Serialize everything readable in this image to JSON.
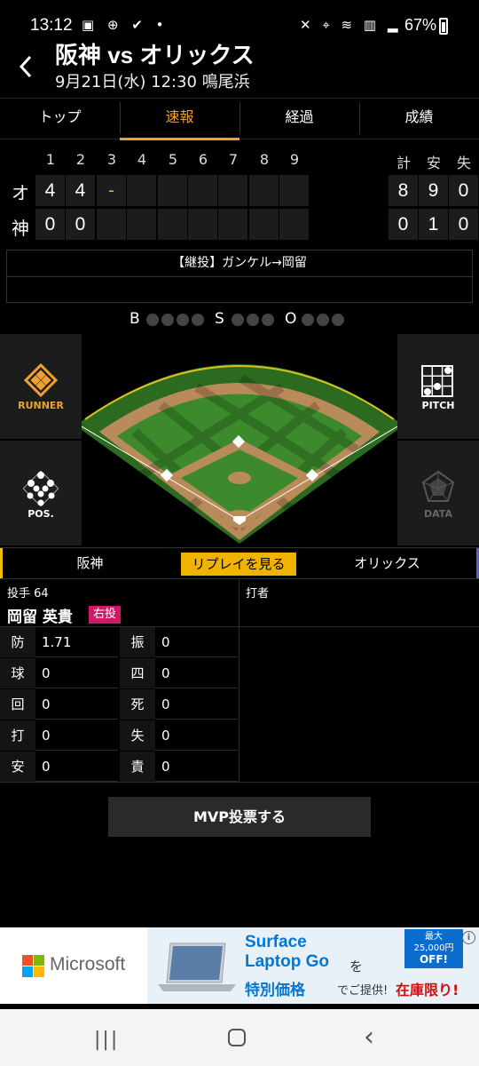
{
  "status_bar": {
    "time": "13:12",
    "left_icons": "▣ ⊕ ✔ •",
    "right_icons": "✕ ⌖ ≋ ▥ ▂",
    "battery": "67%"
  },
  "header": {
    "title": "阪神 vs オリックス",
    "subtitle": "9月21日(水) 12:30 鳴尾浜",
    "back_icon": "‹"
  },
  "tabs": [
    "トップ",
    "速報",
    "経過",
    "成績"
  ],
  "active_tab": 1,
  "scoreboard": {
    "innings": [
      "1",
      "2",
      "3",
      "4",
      "5",
      "6",
      "7",
      "8",
      "9"
    ],
    "total_headers": [
      "計",
      "安",
      "失"
    ],
    "teams": [
      {
        "label": "オ",
        "innings": [
          "4",
          "4",
          "-",
          "",
          "",
          "",
          "",
          "",
          ""
        ],
        "totals": [
          "8",
          "9",
          "0"
        ]
      },
      {
        "label": "神",
        "innings": [
          "0",
          "0",
          "",
          "",
          "",
          "",
          "",
          "",
          ""
        ],
        "totals": [
          "0",
          "1",
          "0"
        ]
      }
    ]
  },
  "announcement": {
    "line1": "【継投】ガンケル→岡留",
    "line2": ""
  },
  "count": {
    "b_label": "B",
    "s_label": "S",
    "o_label": "O",
    "balls": 0,
    "strikes": 0,
    "outs": 0
  },
  "panels": {
    "runner": "RUNNER",
    "pitch": "PITCH",
    "pos": "POS.",
    "data": "DATA"
  },
  "team_switch": {
    "home": "阪神",
    "replay": "リプレイを見る",
    "away": "オリックス"
  },
  "pitcher": {
    "header": "投手 64",
    "name": "岡留 英貴",
    "hand": "右投",
    "stats": [
      {
        "key": "防",
        "value": "1.71"
      },
      {
        "key": "球",
        "value": "0"
      },
      {
        "key": "回",
        "value": "0"
      },
      {
        "key": "打",
        "value": "0"
      },
      {
        "key": "安",
        "value": "0"
      }
    ],
    "stats_right": [
      {
        "key": "振",
        "value": "0"
      },
      {
        "key": "四",
        "value": "0"
      },
      {
        "key": "死",
        "value": "0"
      },
      {
        "key": "失",
        "value": "0"
      },
      {
        "key": "責",
        "value": "0"
      }
    ]
  },
  "batter": {
    "header": "打者"
  },
  "mvp_button": "MVP投票する",
  "ad": {
    "brand": "Microsoft",
    "title1": "Surface",
    "title2": "Laptop Go",
    "wo": "を",
    "tokubetsu": "特別価格",
    "teikyou": "でご提供!",
    "zaiko": "在庫限り!",
    "badge_line1": "最大",
    "badge_line2": "25,000円",
    "badge_line3": "OFF!",
    "info": "i"
  },
  "colors": {
    "accent": "#f0a030",
    "replay": "#f0b400",
    "badge_hand": "#d0186a",
    "field_green": "#3c8a2c",
    "dirt": "#b88a5c"
  }
}
